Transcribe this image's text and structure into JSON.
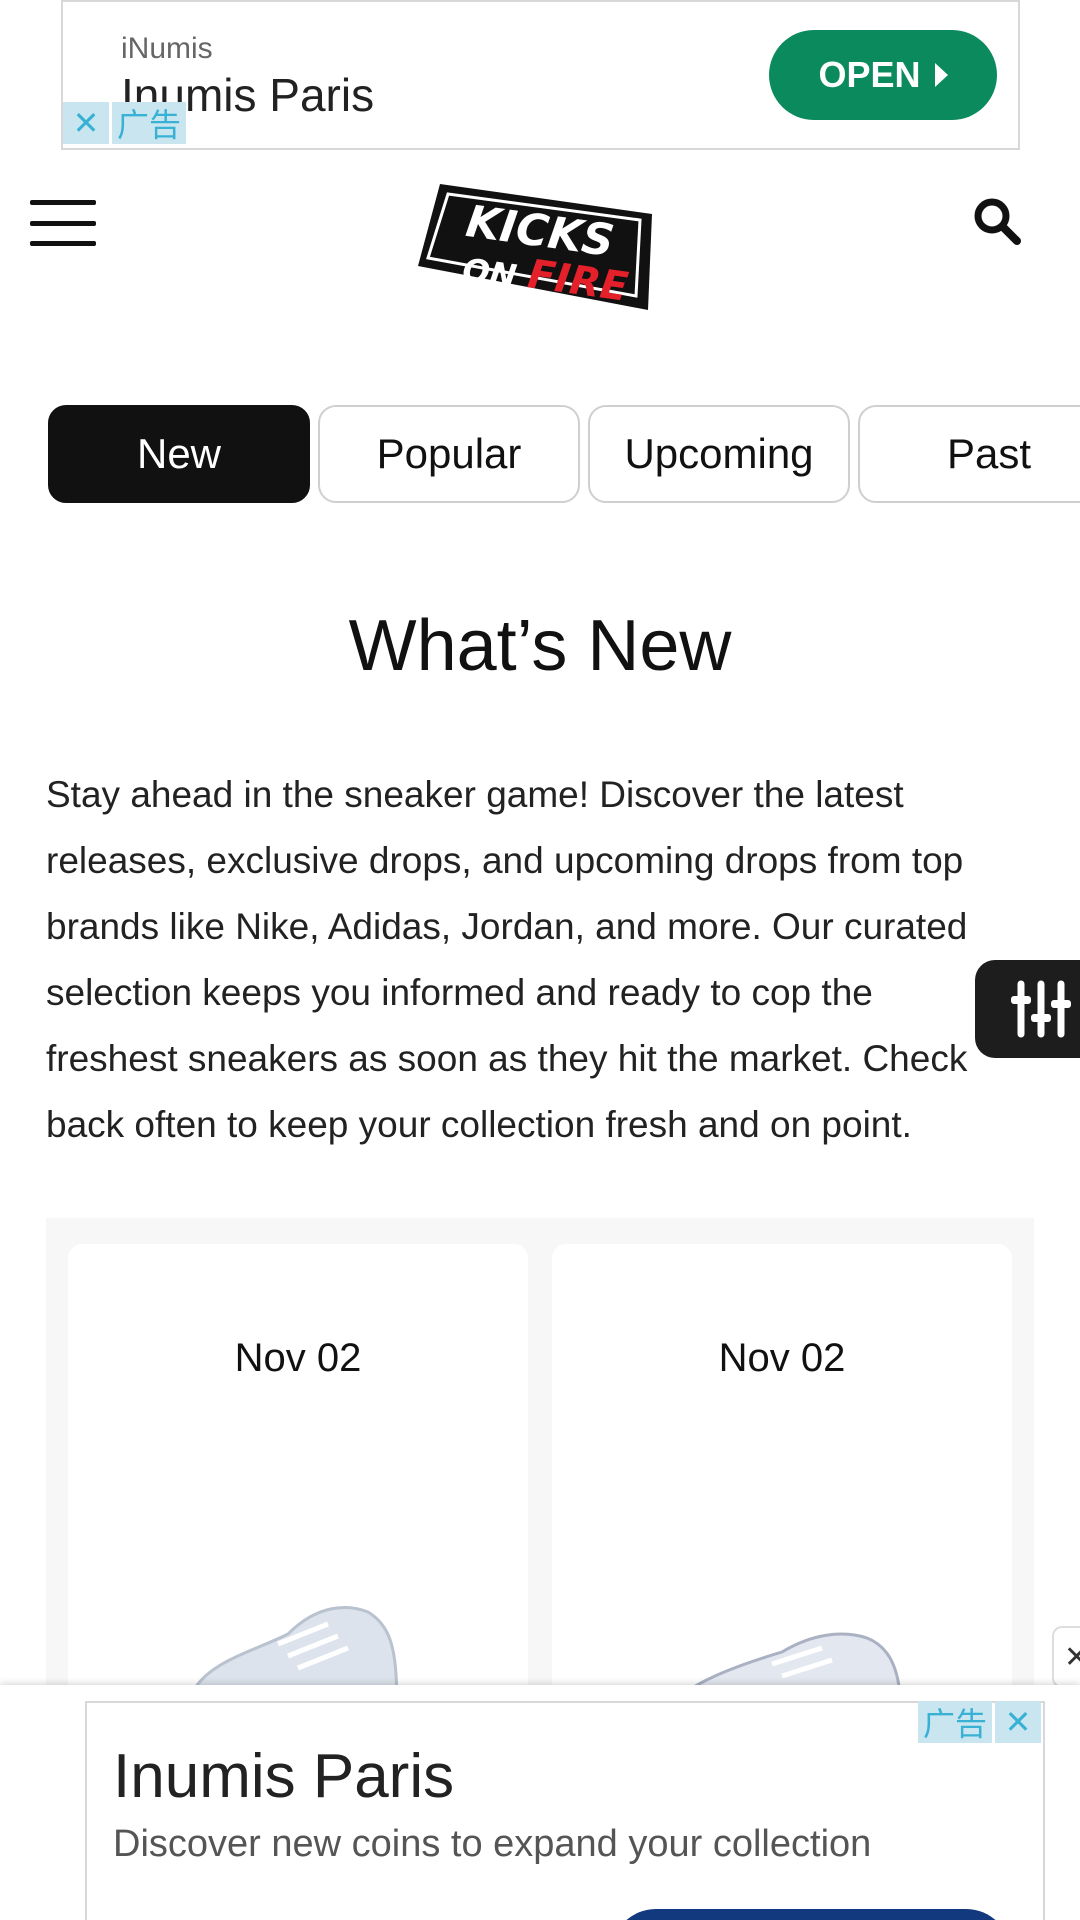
{
  "top_ad": {
    "advertiser": "iNumis",
    "headline": "Inumis Paris",
    "cta_label": "OPEN",
    "ad_label": "广告",
    "close_glyph": "✕"
  },
  "header": {
    "menu_icon": "hamburger-menu-icon",
    "logo_line1": "KICKS",
    "logo_line2_a": "ON",
    "logo_line2_b": "FIRE",
    "search_icon": "search-icon"
  },
  "tabs": [
    {
      "label": "New",
      "active": true
    },
    {
      "label": "Popular",
      "active": false
    },
    {
      "label": "Upcoming",
      "active": false
    },
    {
      "label": "Past",
      "active": false
    }
  ],
  "main": {
    "title": "What’s New",
    "intro": "Stay ahead in the sneaker game! Discover the latest releases, exclusive drops, and upcoming drops from top brands like Nike, Adidas, Jordan, and more. Our curated selection keeps you informed and ready to cop the freshest sneakers as soon as they hit the market. Check back often to keep your collection fresh and on point."
  },
  "filter_icon": "sliders-icon",
  "products": [
    {
      "date": "Nov 02"
    },
    {
      "date": "Nov 02"
    }
  ],
  "bottom_ad": {
    "headline": "Inumis Paris",
    "description": "Discover new coins to expand your collection",
    "ad_label": "广告",
    "close_glyph": "✕"
  },
  "colors": {
    "ad_green": "#0b8a5e",
    "tab_active": "#111111",
    "logo_red": "#e4202a",
    "bottom_cta": "#12397e"
  }
}
